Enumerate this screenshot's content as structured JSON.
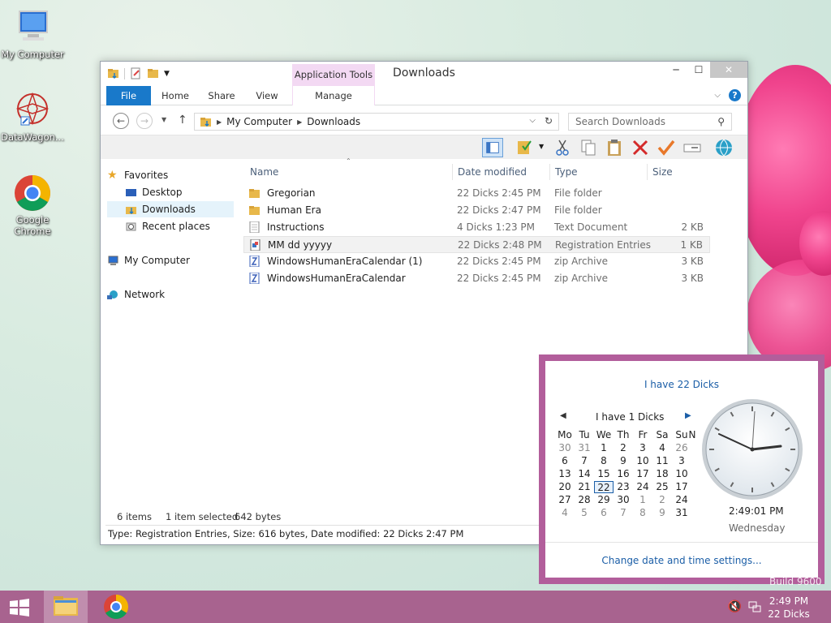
{
  "desktop": {
    "icons": [
      {
        "label": "My Computer"
      },
      {
        "label": "DataWagon..."
      },
      {
        "label": "Google Chrome"
      }
    ],
    "build_text": "Build 9600"
  },
  "window": {
    "title": "Downloads",
    "context_tab_group": "Application Tools",
    "tabs": {
      "file": "File",
      "home": "Home",
      "share": "Share",
      "view": "View",
      "manage": "Manage"
    },
    "help_label": "?",
    "address": {
      "segments": [
        "My Computer",
        "Downloads"
      ]
    },
    "search": {
      "placeholder": "Search Downloads"
    },
    "nav": {
      "favorites": "Favorites",
      "desktop": "Desktop",
      "downloads": "Downloads",
      "recent": "Recent places",
      "computer": "My Computer",
      "network": "Network"
    },
    "columns": {
      "name": "Name",
      "date": "Date modified",
      "type": "Type",
      "size": "Size"
    },
    "files": [
      {
        "name": "Gregorian",
        "date": "22 Dicks 2:45 PM",
        "type": "File folder",
        "size": "",
        "icon": "folder-icon"
      },
      {
        "name": "Human Era",
        "date": "22 Dicks 2:47 PM",
        "type": "File folder",
        "size": "",
        "icon": "folder-icon"
      },
      {
        "name": "Instructions",
        "date": "4 Dicks 1:23 PM",
        "type": "Text Document",
        "size": "2 KB",
        "icon": "text-file-icon"
      },
      {
        "name": "MM dd yyyyy",
        "date": "22 Dicks 2:48 PM",
        "type": "Registration Entries",
        "size": "1 KB",
        "icon": "registry-file-icon"
      },
      {
        "name": "WindowsHumanEraCalendar (1)",
        "date": "22 Dicks 2:45 PM",
        "type": "zip Archive",
        "size": "3 KB",
        "icon": "zip-file-icon"
      },
      {
        "name": "WindowsHumanEraCalendar",
        "date": "22 Dicks 2:45 PM",
        "type": "zip Archive",
        "size": "3 KB",
        "icon": "zip-file-icon"
      }
    ],
    "status": {
      "items": "6 items",
      "selected": "1 item selected",
      "bytes": "642 bytes"
    },
    "details": "Type: Registration Entries, Size: 616 bytes, Date modified: 22 Dicks 2:47 PM"
  },
  "flyout": {
    "header": "I have 22 Dicks",
    "month_label": "I have 1 Dicks",
    "weekdays": [
      "Mo",
      "Tu",
      "We",
      "Th",
      "Fr",
      "Sa",
      "Su",
      "N"
    ],
    "weeks": [
      [
        "30",
        "31",
        "1",
        "2",
        "3",
        "4",
        "26"
      ],
      [
        "6",
        "7",
        "8",
        "9",
        "10",
        "11",
        "3"
      ],
      [
        "13",
        "14",
        "15",
        "16",
        "17",
        "18",
        "10"
      ],
      [
        "20",
        "21",
        "22",
        "23",
        "24",
        "25",
        "17"
      ],
      [
        "27",
        "28",
        "29",
        "30",
        "1",
        "2",
        "24"
      ],
      [
        "4",
        "5",
        "6",
        "7",
        "8",
        "9",
        "31"
      ]
    ],
    "time": "2:49:01 PM",
    "day": "Wednesday",
    "footer_link": "Change date and time settings..."
  },
  "taskbar": {
    "time": "2:49 PM",
    "date": "22 Dicks"
  },
  "colors": {
    "accent": "#1979ca",
    "flyout_border": "#b25e9b",
    "taskbar": "#a8638f",
    "link": "#1b5ea7"
  }
}
